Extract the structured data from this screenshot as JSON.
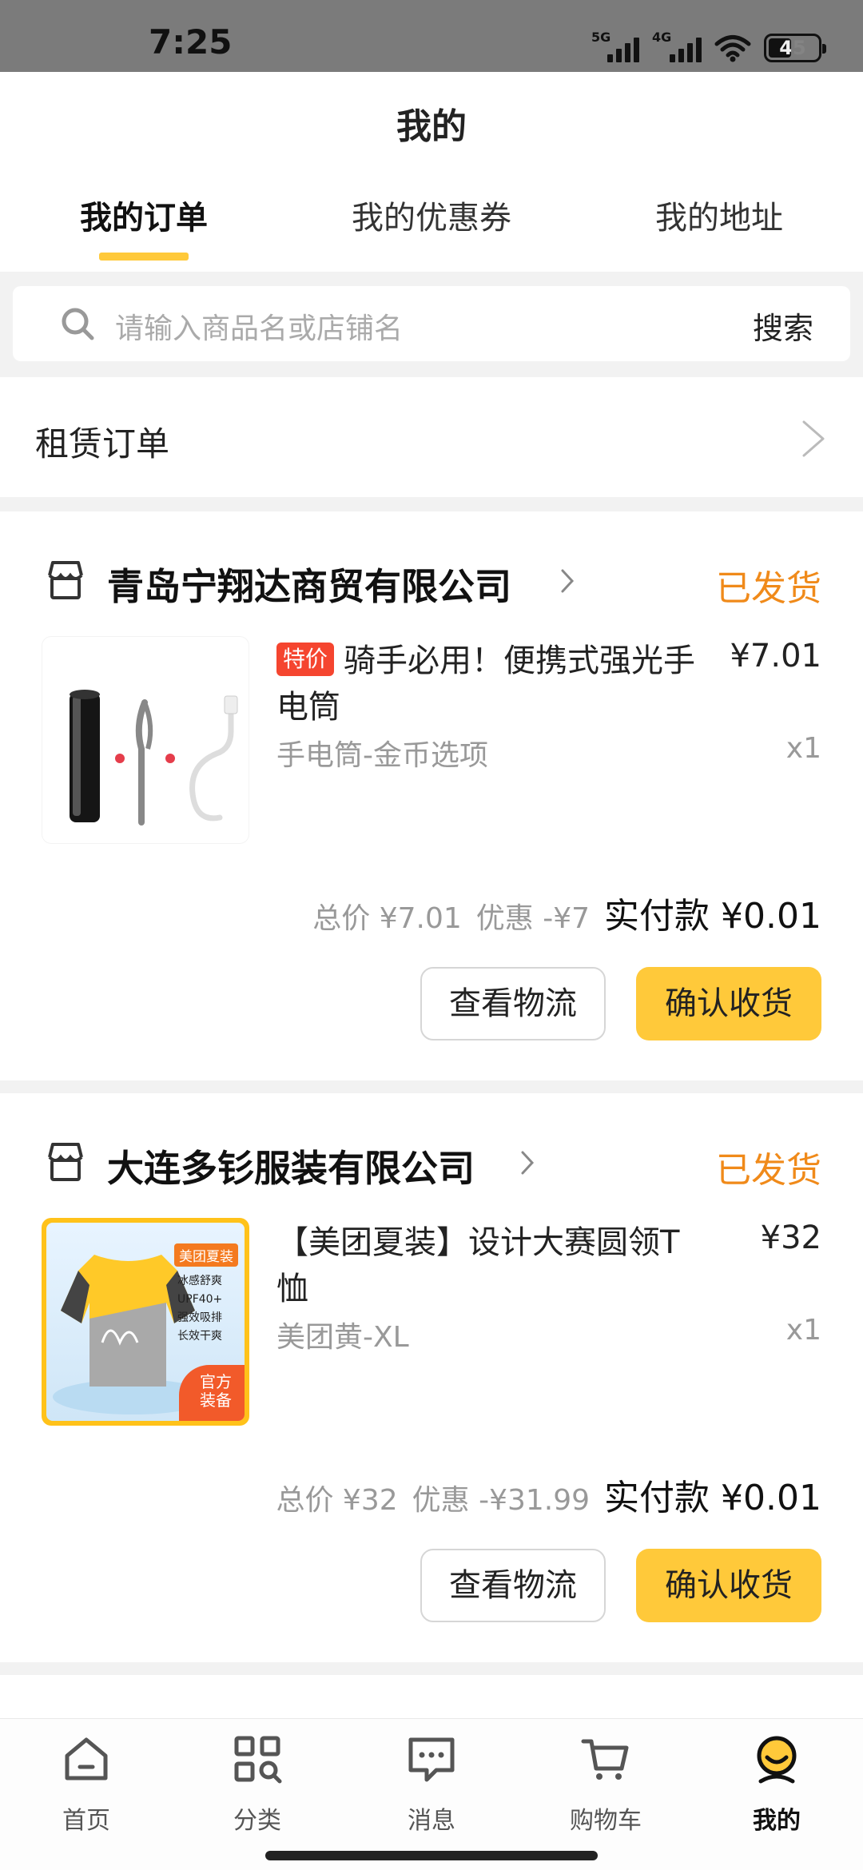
{
  "status_bar": {
    "time": "7:25",
    "signal1_label": "5G",
    "signal2_label": "4G",
    "battery": "45"
  },
  "header": {
    "title": "我的"
  },
  "tabs": [
    {
      "label": "我的订单",
      "active": true
    },
    {
      "label": "我的优惠券",
      "active": false
    },
    {
      "label": "我的地址",
      "active": false
    }
  ],
  "search": {
    "placeholder": "请输入商品名或店铺名",
    "button": "搜索"
  },
  "rental": {
    "label": "租赁订单"
  },
  "orders": [
    {
      "shop": "青岛宁翔达商贸有限公司",
      "status": "已发货",
      "tag": "特价",
      "product_name": "骑手必用！便携式强光手电筒",
      "price": "¥7.01",
      "spec": "手电筒-金币选项",
      "qty": "x1",
      "total": "总价 ¥7.01",
      "discount": "优惠 -¥7",
      "paid": "实付款 ¥0.01",
      "btn_logistics": "查看物流",
      "btn_confirm": "确认收货"
    },
    {
      "shop": "大连多钐服装有限公司",
      "status": "已发货",
      "product_name": "【美团夏装】设计大赛圆领T恤",
      "price": "¥32",
      "spec": "美团黄-XL",
      "qty": "x1",
      "total": "总价 ¥32",
      "discount": "优惠 -¥31.99",
      "paid": "实付款 ¥0.01",
      "btn_logistics": "查看物流",
      "btn_confirm": "确认收货",
      "image_text": {
        "badge": "美团夏装",
        "features": [
          "冰感舒爽",
          "UPF40+",
          "强效吸排",
          "长效干爽"
        ],
        "corner": [
          "官方",
          "装备"
        ]
      }
    }
  ],
  "tabbar": [
    {
      "label": "首页",
      "icon": "home-icon",
      "active": false
    },
    {
      "label": "分类",
      "icon": "category-icon",
      "active": false
    },
    {
      "label": "消息",
      "icon": "message-icon",
      "active": false
    },
    {
      "label": "购物车",
      "icon": "cart-icon",
      "active": false
    },
    {
      "label": "我的",
      "icon": "profile-icon",
      "active": true
    }
  ],
  "colors": {
    "accent": "#ffc93a",
    "status": "#f08a1a",
    "tag": "#f5452f"
  }
}
